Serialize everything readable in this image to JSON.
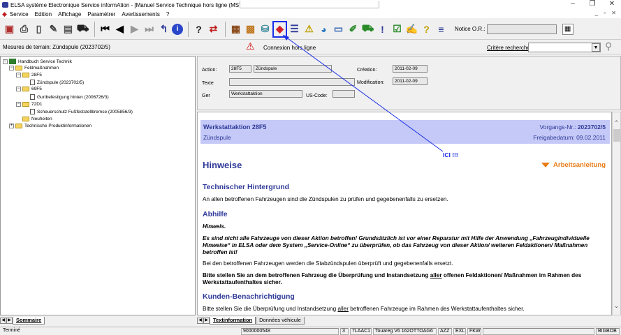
{
  "window": {
    "title": "ELSA système Electronique Service informAtion - [Manuel Service Technique hors ligne (MST)]"
  },
  "menu": {
    "items": [
      "Service",
      "Edition",
      "Affichage",
      "Paramétrer",
      "Avertissements",
      "?"
    ]
  },
  "toolbar": {
    "notice_label": "Notice O.R.:",
    "notice_value": ""
  },
  "statusrow": {
    "mesures": "Mesures de terrain: Zündspule (2023702/5)",
    "connexion": "Connexion hors ligne",
    "critere_label": "Critère recherche",
    "critere_value": ""
  },
  "tree": {
    "root": "Handbuch Service Technik",
    "n1": "Feldmaßnahmen",
    "n2": "28F5",
    "n3": "Zündspule (2023702/5)",
    "n4": "69F5",
    "n5": "Gurtbefestigung hinten (2006726/3)",
    "n6": "72D1",
    "n7": "Scheuerschutz Fußfeststellbremse (2005856/3)",
    "n8": "Neuheiten",
    "n9": "Technische Produktinformationen"
  },
  "left_tabs": {
    "active": "Sommaire"
  },
  "form": {
    "action_label": "Action:",
    "action_code": "28F5",
    "action_name": "Zündspule",
    "creation_label": "Création:",
    "creation_value": "2011-02-09",
    "texte_label": "Texte",
    "texte_value": "",
    "modification_label": "Modification:",
    "modification_value": "2011-02-09",
    "ger_label": "Ger",
    "ger_value": "Werkstattaktion",
    "uscode_label": "US-Code:",
    "uscode_value": ""
  },
  "doc": {
    "header_title": "Werkstattaktion 28F5",
    "header_sub": "Zündspule",
    "vorgang_label": "Vorgangs-Nr.:",
    "vorgang_value": "2023702/5",
    "freigabe": "Freigabedatum: 09.02.2011",
    "hinweise": "Hinweise",
    "arbeitsanleitung": "Arbeitsanleitung",
    "h_tech": "Technischer Hintergrund",
    "p_tech": "An allen betroffenen Fahrzeugen sind die Zündspulen zu prüfen und gegebenenfalls zu ersetzen.",
    "h_abhilfe": "Abhilfe",
    "p_hinweis": "Hinweis.",
    "p_nicht": "Es sind nicht alle Fahrzeuge von dieser Aktion betroffen! Grundsätzlich ist vor einer Reparatur mit Hilfe der Anwendung „Fahrzeugindividuelle Hinweise“ in ELSA oder dem System „Service-Online“ zu überprüfen, ob das Fahrzeug von dieser Aktion/ weiteren Feldaktionen/ Maßnahmen betroffen ist!",
    "p_stab": "Bei den betroffenen Fahrzeugen werden die Stabzündspulen überprüft und gegebenenfalls ersetzt.",
    "p_bitte_pre": "Bitte stellen Sie an dem betroffenen Fahrzeug die Überprüfung und Instandsetzung ",
    "p_bitte_u": "aller",
    "p_bitte_post": " offenen Feldaktionen/ Maßnahmen im Rahmen des Werkstattaufenthaltes sicher.",
    "h_kunden": "Kunden-Benachrichtigung",
    "p_kunden_pre": "Bitte stellen Sie die Überprüfung und Instandsetzung ",
    "p_kunden_u": "aller",
    "p_kunden_post": " betroffenen Fahrzeuge im Rahmen des Werkstattaufenthaltes sicher."
  },
  "right_tabs": {
    "active": "Textinformation",
    "inactive": "Données véhicule"
  },
  "statusbar": {
    "left": "Terminé",
    "id": "9000000548",
    "f1": "3",
    "f2": "7LAAC1",
    "f3": "Touareg V6 162OTTOAG6",
    "f4": "AZZ",
    "f5": "EXL",
    "f6": "FKW",
    "user": "BIGBOB"
  },
  "annotation": {
    "text": "ICI !!!",
    "color": "#1a2ee8"
  }
}
